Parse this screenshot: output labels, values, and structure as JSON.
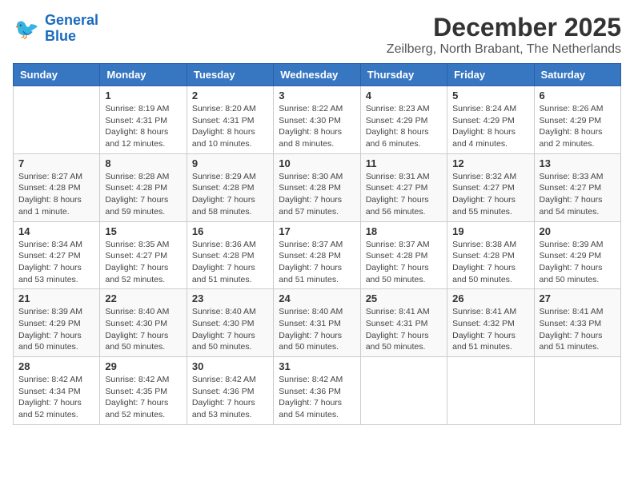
{
  "header": {
    "logo_line1": "General",
    "logo_line2": "Blue",
    "month_title": "December 2025",
    "location": "Zeilberg, North Brabant, The Netherlands"
  },
  "days_of_week": [
    "Sunday",
    "Monday",
    "Tuesday",
    "Wednesday",
    "Thursday",
    "Friday",
    "Saturday"
  ],
  "weeks": [
    [
      {
        "day": "",
        "info": ""
      },
      {
        "day": "1",
        "info": "Sunrise: 8:19 AM\nSunset: 4:31 PM\nDaylight: 8 hours\nand 12 minutes."
      },
      {
        "day": "2",
        "info": "Sunrise: 8:20 AM\nSunset: 4:31 PM\nDaylight: 8 hours\nand 10 minutes."
      },
      {
        "day": "3",
        "info": "Sunrise: 8:22 AM\nSunset: 4:30 PM\nDaylight: 8 hours\nand 8 minutes."
      },
      {
        "day": "4",
        "info": "Sunrise: 8:23 AM\nSunset: 4:29 PM\nDaylight: 8 hours\nand 6 minutes."
      },
      {
        "day": "5",
        "info": "Sunrise: 8:24 AM\nSunset: 4:29 PM\nDaylight: 8 hours\nand 4 minutes."
      },
      {
        "day": "6",
        "info": "Sunrise: 8:26 AM\nSunset: 4:29 PM\nDaylight: 8 hours\nand 2 minutes."
      }
    ],
    [
      {
        "day": "7",
        "info": "Sunrise: 8:27 AM\nSunset: 4:28 PM\nDaylight: 8 hours\nand 1 minute."
      },
      {
        "day": "8",
        "info": "Sunrise: 8:28 AM\nSunset: 4:28 PM\nDaylight: 7 hours\nand 59 minutes."
      },
      {
        "day": "9",
        "info": "Sunrise: 8:29 AM\nSunset: 4:28 PM\nDaylight: 7 hours\nand 58 minutes."
      },
      {
        "day": "10",
        "info": "Sunrise: 8:30 AM\nSunset: 4:28 PM\nDaylight: 7 hours\nand 57 minutes."
      },
      {
        "day": "11",
        "info": "Sunrise: 8:31 AM\nSunset: 4:27 PM\nDaylight: 7 hours\nand 56 minutes."
      },
      {
        "day": "12",
        "info": "Sunrise: 8:32 AM\nSunset: 4:27 PM\nDaylight: 7 hours\nand 55 minutes."
      },
      {
        "day": "13",
        "info": "Sunrise: 8:33 AM\nSunset: 4:27 PM\nDaylight: 7 hours\nand 54 minutes."
      }
    ],
    [
      {
        "day": "14",
        "info": "Sunrise: 8:34 AM\nSunset: 4:27 PM\nDaylight: 7 hours\nand 53 minutes."
      },
      {
        "day": "15",
        "info": "Sunrise: 8:35 AM\nSunset: 4:27 PM\nDaylight: 7 hours\nand 52 minutes."
      },
      {
        "day": "16",
        "info": "Sunrise: 8:36 AM\nSunset: 4:28 PM\nDaylight: 7 hours\nand 51 minutes."
      },
      {
        "day": "17",
        "info": "Sunrise: 8:37 AM\nSunset: 4:28 PM\nDaylight: 7 hours\nand 51 minutes."
      },
      {
        "day": "18",
        "info": "Sunrise: 8:37 AM\nSunset: 4:28 PM\nDaylight: 7 hours\nand 50 minutes."
      },
      {
        "day": "19",
        "info": "Sunrise: 8:38 AM\nSunset: 4:28 PM\nDaylight: 7 hours\nand 50 minutes."
      },
      {
        "day": "20",
        "info": "Sunrise: 8:39 AM\nSunset: 4:29 PM\nDaylight: 7 hours\nand 50 minutes."
      }
    ],
    [
      {
        "day": "21",
        "info": "Sunrise: 8:39 AM\nSunset: 4:29 PM\nDaylight: 7 hours\nand 50 minutes."
      },
      {
        "day": "22",
        "info": "Sunrise: 8:40 AM\nSunset: 4:30 PM\nDaylight: 7 hours\nand 50 minutes."
      },
      {
        "day": "23",
        "info": "Sunrise: 8:40 AM\nSunset: 4:30 PM\nDaylight: 7 hours\nand 50 minutes."
      },
      {
        "day": "24",
        "info": "Sunrise: 8:40 AM\nSunset: 4:31 PM\nDaylight: 7 hours\nand 50 minutes."
      },
      {
        "day": "25",
        "info": "Sunrise: 8:41 AM\nSunset: 4:31 PM\nDaylight: 7 hours\nand 50 minutes."
      },
      {
        "day": "26",
        "info": "Sunrise: 8:41 AM\nSunset: 4:32 PM\nDaylight: 7 hours\nand 51 minutes."
      },
      {
        "day": "27",
        "info": "Sunrise: 8:41 AM\nSunset: 4:33 PM\nDaylight: 7 hours\nand 51 minutes."
      }
    ],
    [
      {
        "day": "28",
        "info": "Sunrise: 8:42 AM\nSunset: 4:34 PM\nDaylight: 7 hours\nand 52 minutes."
      },
      {
        "day": "29",
        "info": "Sunrise: 8:42 AM\nSunset: 4:35 PM\nDaylight: 7 hours\nand 52 minutes."
      },
      {
        "day": "30",
        "info": "Sunrise: 8:42 AM\nSunset: 4:36 PM\nDaylight: 7 hours\nand 53 minutes."
      },
      {
        "day": "31",
        "info": "Sunrise: 8:42 AM\nSunset: 4:36 PM\nDaylight: 7 hours\nand 54 minutes."
      },
      {
        "day": "",
        "info": ""
      },
      {
        "day": "",
        "info": ""
      },
      {
        "day": "",
        "info": ""
      }
    ]
  ]
}
